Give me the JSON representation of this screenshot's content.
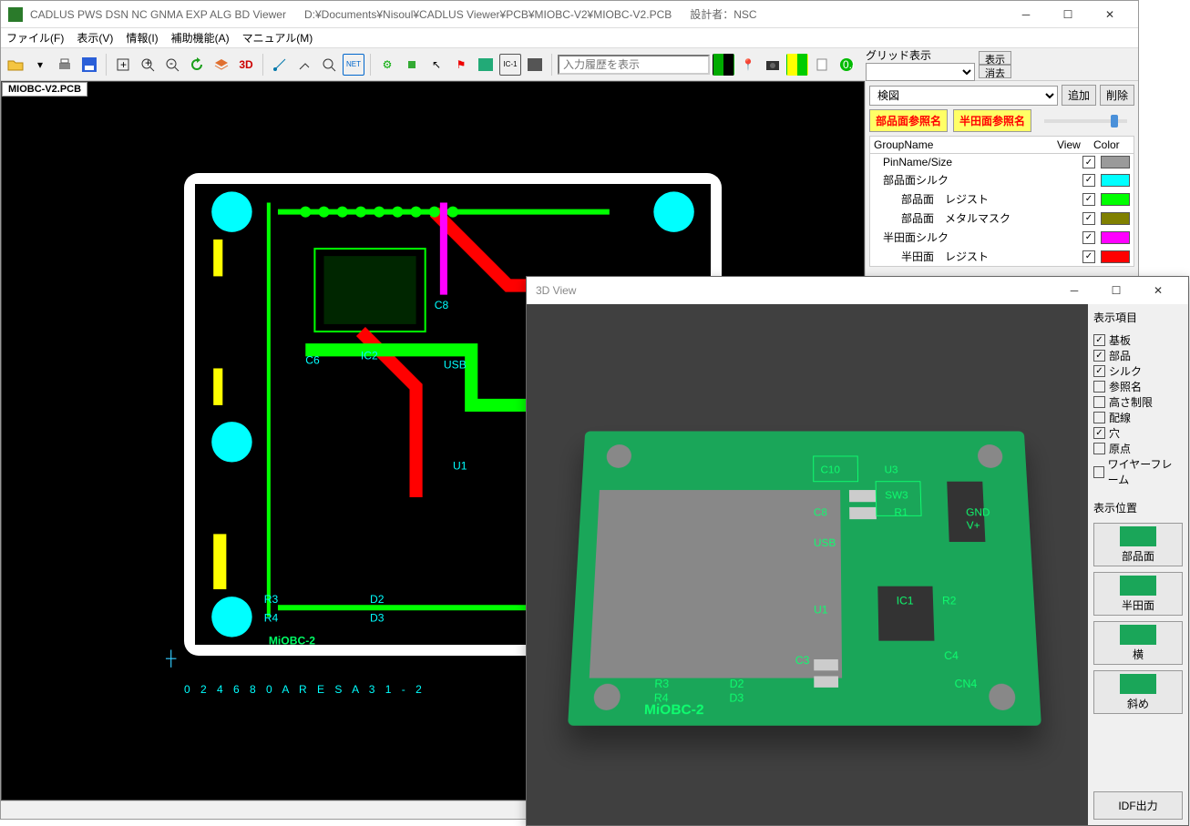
{
  "title": {
    "app": "CADLUS PWS  DSN  NC  GNMA  EXP  ALG  BD Viewer",
    "path": "D:¥Documents¥Nisoul¥CADLUS Viewer¥PCB¥MIOBC-V2¥MIOBC-V2.PCB",
    "designer_label": "設計者：NSC"
  },
  "menu": {
    "file": "ファイル(F)",
    "view": "表示(V)",
    "info": "情報(I)",
    "aux": "補助機能(A)",
    "manual": "マニュアル(M)"
  },
  "toolbar": {
    "history_placeholder": "入力履歴を表示",
    "grid_label": "グリッド表示",
    "grid_show": "表示",
    "grid_clear": "消去"
  },
  "doc_tab": "MIOBC-V2.PCB",
  "footer_text": "0 2 4 6 8 0 A R E S A 3 1 - 2",
  "side": {
    "combo": "検図",
    "add": "追加",
    "del": "削除",
    "ref_top": "部品面参照名",
    "ref_bot": "半田面参照名",
    "head_group": "GroupName",
    "head_view": "View",
    "head_color": "Color",
    "layers": [
      {
        "name": "PinName/Size",
        "indent": false,
        "checked": true,
        "color": "#9a9a9a"
      },
      {
        "name": "部品面シルク",
        "indent": false,
        "checked": true,
        "color": "#00ffff"
      },
      {
        "name": "部品面　レジスト",
        "indent": true,
        "checked": true,
        "color": "#00ff00"
      },
      {
        "name": "部品面　メタルマスク",
        "indent": true,
        "checked": true,
        "color": "#808000"
      },
      {
        "name": "半田面シルク",
        "indent": false,
        "checked": true,
        "color": "#ff00ff"
      },
      {
        "name": "半田面　レジスト",
        "indent": true,
        "checked": true,
        "color": "#ff0000"
      }
    ]
  },
  "view3d": {
    "title": "3D View",
    "section_items": "表示項目",
    "opts": [
      {
        "label": "基板",
        "checked": true
      },
      {
        "label": "部品",
        "checked": true
      },
      {
        "label": "シルク",
        "checked": true
      },
      {
        "label": "参照名",
        "checked": false
      },
      {
        "label": "高さ制限",
        "checked": false
      },
      {
        "label": "配線",
        "checked": false
      },
      {
        "label": "穴",
        "checked": true
      },
      {
        "label": "原点",
        "checked": false
      },
      {
        "label": "ワイヤーフレーム",
        "checked": false
      }
    ],
    "section_pos": "表示位置",
    "pos": [
      "部品面",
      "半田面",
      "横",
      "斜め"
    ],
    "idf": "IDF出力",
    "board_label": "MiOBC-2"
  }
}
